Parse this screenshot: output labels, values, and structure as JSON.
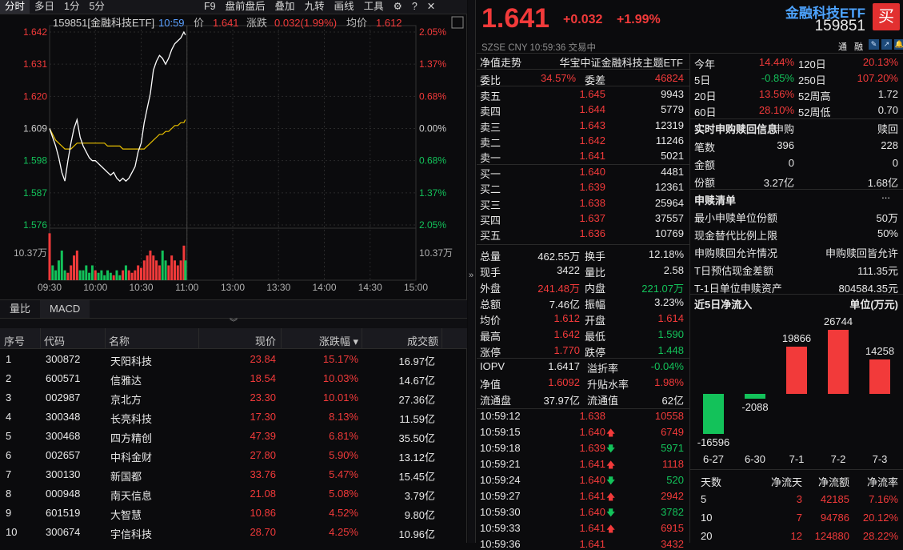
{
  "toolbar": {
    "tabs": [
      "分时",
      "多日",
      "1分",
      "5分"
    ],
    "active": "分时",
    "right": [
      "F9",
      "盘前盘后",
      "叠加",
      "九转",
      "画线",
      "工具"
    ]
  },
  "chart": {
    "header": {
      "code": "159851[金融科技ETF]",
      "time": "10:59",
      "price_label": "价",
      "price": "1.641",
      "chg_label": "涨跌",
      "chg": "0.032(1.99%)",
      "avg_label": "均价",
      "avg": "1.612"
    },
    "y_labels": [
      "1.642",
      "1.631",
      "1.620",
      "1.609",
      "1.598",
      "1.587",
      "1.576"
    ],
    "pct_labels": [
      "2.05%",
      "1.37%",
      "0.68%",
      "0.00%",
      "0.68%",
      "1.37%",
      "2.05%"
    ],
    "vol_label": "10.37万",
    "x_labels": [
      "09:30",
      "10:00",
      "10:30",
      "11:00",
      "13:00",
      "13:30",
      "14:00",
      "14:30",
      "15:00"
    ],
    "colors": {
      "up": "#f23a3a",
      "down": "#13c25a",
      "price": "#ffffff",
      "avg": "#e8c000"
    }
  },
  "chart_data": {
    "type": "line",
    "x": [
      "09:30",
      "09:32",
      "09:34",
      "09:36",
      "09:38",
      "09:40",
      "09:42",
      "09:44",
      "09:46",
      "09:48",
      "09:50",
      "09:52",
      "09:54",
      "09:56",
      "09:58",
      "10:00",
      "10:02",
      "10:04",
      "10:06",
      "10:08",
      "10:10",
      "10:12",
      "10:14",
      "10:16",
      "10:18",
      "10:20",
      "10:22",
      "10:24",
      "10:26",
      "10:28",
      "10:30",
      "10:32",
      "10:34",
      "10:36",
      "10:38",
      "10:40",
      "10:42",
      "10:44",
      "10:46",
      "10:48",
      "10:50",
      "10:52",
      "10:54",
      "10:56",
      "10:58",
      "10:59"
    ],
    "series": [
      {
        "values": [
          1.609,
          1.606,
          1.603,
          1.599,
          1.594,
          1.591,
          1.598,
          1.604,
          1.609,
          1.612,
          1.606,
          1.603,
          1.601,
          1.599,
          1.598,
          1.598,
          1.597,
          1.596,
          1.595,
          1.594,
          1.593,
          1.594,
          1.592,
          1.591,
          1.592,
          1.591,
          1.592,
          1.594,
          1.596,
          1.601,
          1.604,
          1.611,
          1.616,
          1.621,
          1.629,
          1.632,
          1.634,
          1.633,
          1.631,
          1.633,
          1.636,
          1.638,
          1.639,
          1.64,
          1.642,
          1.641
        ]
      },
      {
        "values": [
          1.609,
          1.607,
          1.605,
          1.604,
          1.603,
          1.602,
          1.602,
          1.602,
          1.603,
          1.604,
          1.604,
          1.604,
          1.604,
          1.604,
          1.604,
          1.604,
          1.604,
          1.604,
          1.604,
          1.603,
          1.603,
          1.603,
          1.603,
          1.603,
          1.602,
          1.602,
          1.602,
          1.602,
          1.602,
          1.602,
          1.602,
          1.602,
          1.603,
          1.604,
          1.605,
          1.606,
          1.607,
          1.607,
          1.608,
          1.608,
          1.609,
          1.61,
          1.61,
          1.611,
          1.611,
          1.612
        ]
      }
    ],
    "ylim": [
      1.576,
      1.642
    ],
    "volume": [
      9.5,
      3,
      2,
      4,
      6,
      2,
      1.5,
      3,
      5,
      6,
      2,
      2,
      3,
      1.5,
      3,
      2,
      1.5,
      2,
      1,
      2,
      1.5,
      1,
      2,
      1,
      2,
      3,
      2,
      1.5,
      2,
      3,
      2.5,
      4,
      5,
      6,
      5,
      4,
      3,
      6,
      4,
      3,
      5,
      4,
      3,
      4,
      7,
      4
    ]
  },
  "ind_tabs": [
    "量比",
    "MACD"
  ],
  "rank": {
    "headers": [
      "序号",
      "代码",
      "名称",
      "现价",
      "涨跌幅",
      "成交额"
    ],
    "rows": [
      [
        "1",
        "300872",
        "天阳科技",
        "23.84",
        "15.17%",
        "16.97亿"
      ],
      [
        "2",
        "600571",
        "信雅达",
        "18.54",
        "10.03%",
        "14.67亿"
      ],
      [
        "3",
        "002987",
        "京北方",
        "23.30",
        "10.01%",
        "27.36亿"
      ],
      [
        "4",
        "300348",
        "长亮科技",
        "17.30",
        "8.13%",
        "11.59亿"
      ],
      [
        "5",
        "300468",
        "四方精创",
        "47.39",
        "6.81%",
        "35.50亿"
      ],
      [
        "6",
        "002657",
        "中科金财",
        "27.80",
        "5.90%",
        "13.12亿"
      ],
      [
        "7",
        "300130",
        "新国都",
        "33.76",
        "5.47%",
        "15.45亿"
      ],
      [
        "8",
        "000948",
        "南天信息",
        "21.08",
        "5.08%",
        "3.79亿"
      ],
      [
        "9",
        "601519",
        "大智慧",
        "10.86",
        "4.52%",
        "9.80亿"
      ],
      [
        "10",
        "300674",
        "宇信科技",
        "28.70",
        "4.25%",
        "10.96亿"
      ]
    ]
  },
  "quote": {
    "price": "1.641",
    "chg": "+0.032",
    "pct": "+1.99%",
    "exch": "SZSE",
    "cur": "CNY",
    "time": "10:59:36",
    "status": "交易中",
    "name": "金融科技ETF",
    "code": "159851",
    "buy": "买",
    "flags": [
      "通",
      "融"
    ]
  },
  "nav": {
    "label": "净值走势",
    "name": "华宝中证金融科技主题ETF"
  },
  "order": {
    "wb_label": "委比",
    "wb": "34.57%",
    "wc_label": "委差",
    "wc": "46824",
    "sells": [
      [
        "卖五",
        "1.645",
        "9943"
      ],
      [
        "卖四",
        "1.644",
        "5779"
      ],
      [
        "卖三",
        "1.643",
        "12319"
      ],
      [
        "卖二",
        "1.642",
        "11246"
      ],
      [
        "卖一",
        "1.641",
        "5021"
      ]
    ],
    "buys": [
      [
        "买一",
        "1.640",
        "4481"
      ],
      [
        "买二",
        "1.639",
        "12361"
      ],
      [
        "买三",
        "1.638",
        "25964"
      ],
      [
        "买四",
        "1.637",
        "37557"
      ],
      [
        "买五",
        "1.636",
        "10769"
      ]
    ]
  },
  "stats": [
    [
      [
        "总量",
        "462.55万",
        "w"
      ],
      [
        "换手",
        "12.18%",
        "w"
      ]
    ],
    [
      [
        "现手",
        "3422",
        "w"
      ],
      [
        "量比",
        "2.58",
        "w"
      ]
    ],
    [
      [
        "外盘",
        "241.48万",
        "r"
      ],
      [
        "内盘",
        "221.07万",
        "g"
      ]
    ],
    [
      [
        "总额",
        "7.46亿",
        "w"
      ],
      [
        "振幅",
        "3.23%",
        "w"
      ]
    ],
    [
      [
        "均价",
        "1.612",
        "r"
      ],
      [
        "开盘",
        "1.614",
        "r"
      ]
    ],
    [
      [
        "最高",
        "1.642",
        "r"
      ],
      [
        "最低",
        "1.590",
        "g"
      ]
    ],
    [
      [
        "涨停",
        "1.770",
        "r"
      ],
      [
        "跌停",
        "1.448",
        "g"
      ]
    ]
  ],
  "iopv": [
    [
      [
        "IOPV",
        "1.6417",
        "w"
      ],
      [
        "溢折率",
        "-0.04%",
        "g"
      ]
    ],
    [
      [
        "净值",
        "1.6092",
        "r"
      ],
      [
        "升贴水率",
        "1.98%",
        "r"
      ]
    ],
    [
      [
        "流通盘",
        "37.97亿",
        "w"
      ],
      [
        "流通值",
        "62亿",
        "w"
      ]
    ]
  ],
  "ticks": [
    [
      "10:59:12",
      "1.638",
      "",
      "10558"
    ],
    [
      "10:59:15",
      "1.640",
      "up",
      "6749"
    ],
    [
      "10:59:18",
      "1.639",
      "down",
      "5971"
    ],
    [
      "10:59:21",
      "1.641",
      "up",
      "1118"
    ],
    [
      "10:59:24",
      "1.640",
      "down",
      "520"
    ],
    [
      "10:59:27",
      "1.641",
      "up",
      "2942"
    ],
    [
      "10:59:30",
      "1.640",
      "down",
      "3782"
    ],
    [
      "10:59:33",
      "1.641",
      "up",
      "6915"
    ],
    [
      "10:59:36",
      "1.641",
      "",
      "3432"
    ]
  ],
  "perf": [
    [
      [
        "今年",
        "14.44%",
        "r"
      ],
      [
        "120日",
        "20.13%",
        "r"
      ]
    ],
    [
      [
        "5日",
        "-0.85%",
        "g"
      ],
      [
        "250日",
        "107.20%",
        "r"
      ]
    ],
    [
      [
        "20日",
        "13.56%",
        "r"
      ],
      [
        "52周高",
        "1.72",
        "w"
      ]
    ],
    [
      [
        "60日",
        "28.10%",
        "r"
      ],
      [
        "52周低",
        "0.70",
        "w"
      ]
    ]
  ],
  "creation": {
    "title": "实时申购赎回信息",
    "col1": "申购",
    "col2": "赎回",
    "rows": [
      [
        "笔数",
        "396",
        "228"
      ],
      [
        "金额",
        "0",
        "0"
      ],
      [
        "份额",
        "3.27亿",
        "1.68亿"
      ]
    ]
  },
  "redeem": {
    "title": "申赎清单",
    "more": "...",
    "rows": [
      [
        "最小申赎单位份额",
        "50万"
      ],
      [
        "现金替代比例上限",
        "50%"
      ],
      [
        "申购赎回允许情况",
        "申购赎回皆允许"
      ],
      [
        "T日预估现金差额",
        "111.35元"
      ],
      [
        "T-1日单位申赎资产",
        "804584.35元"
      ]
    ]
  },
  "flow": {
    "title": "近5日净流入",
    "unit": "单位(万元)",
    "chart_data": {
      "type": "bar",
      "categories": [
        "6-27",
        "6-30",
        "7-1",
        "7-2",
        "7-3"
      ],
      "values": [
        -16596,
        -2088,
        19866,
        26744,
        14258
      ]
    }
  },
  "flowtable": {
    "headers": [
      "天数",
      "净流天",
      "净流额",
      "净流率"
    ],
    "rows": [
      [
        "5",
        "3",
        "42185",
        "7.16%"
      ],
      [
        "10",
        "7",
        "94786",
        "20.12%"
      ],
      [
        "20",
        "12",
        "124880",
        "28.22%"
      ]
    ]
  }
}
